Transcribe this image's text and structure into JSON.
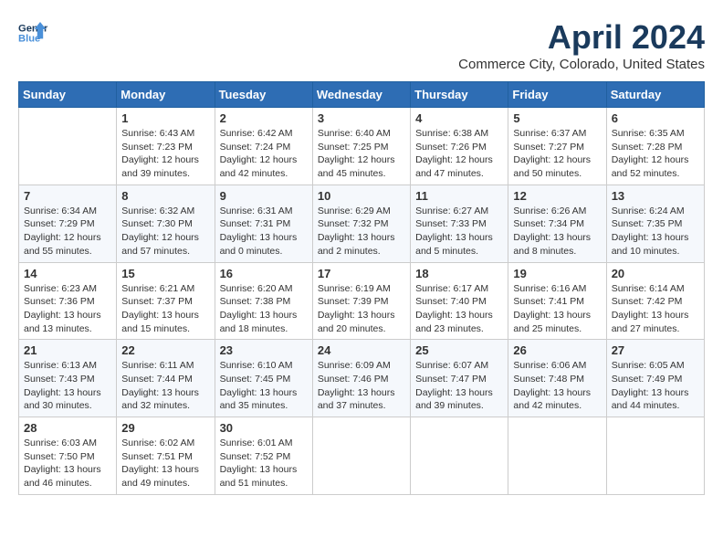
{
  "header": {
    "logo_general": "General",
    "logo_blue": "Blue",
    "month_year": "April 2024",
    "location": "Commerce City, Colorado, United States"
  },
  "days_of_week": [
    "Sunday",
    "Monday",
    "Tuesday",
    "Wednesday",
    "Thursday",
    "Friday",
    "Saturday"
  ],
  "weeks": [
    [
      {
        "day": "",
        "sunrise": "",
        "sunset": "",
        "daylight": ""
      },
      {
        "day": "1",
        "sunrise": "Sunrise: 6:43 AM",
        "sunset": "Sunset: 7:23 PM",
        "daylight": "Daylight: 12 hours and 39 minutes."
      },
      {
        "day": "2",
        "sunrise": "Sunrise: 6:42 AM",
        "sunset": "Sunset: 7:24 PM",
        "daylight": "Daylight: 12 hours and 42 minutes."
      },
      {
        "day": "3",
        "sunrise": "Sunrise: 6:40 AM",
        "sunset": "Sunset: 7:25 PM",
        "daylight": "Daylight: 12 hours and 45 minutes."
      },
      {
        "day": "4",
        "sunrise": "Sunrise: 6:38 AM",
        "sunset": "Sunset: 7:26 PM",
        "daylight": "Daylight: 12 hours and 47 minutes."
      },
      {
        "day": "5",
        "sunrise": "Sunrise: 6:37 AM",
        "sunset": "Sunset: 7:27 PM",
        "daylight": "Daylight: 12 hours and 50 minutes."
      },
      {
        "day": "6",
        "sunrise": "Sunrise: 6:35 AM",
        "sunset": "Sunset: 7:28 PM",
        "daylight": "Daylight: 12 hours and 52 minutes."
      }
    ],
    [
      {
        "day": "7",
        "sunrise": "Sunrise: 6:34 AM",
        "sunset": "Sunset: 7:29 PM",
        "daylight": "Daylight: 12 hours and 55 minutes."
      },
      {
        "day": "8",
        "sunrise": "Sunrise: 6:32 AM",
        "sunset": "Sunset: 7:30 PM",
        "daylight": "Daylight: 12 hours and 57 minutes."
      },
      {
        "day": "9",
        "sunrise": "Sunrise: 6:31 AM",
        "sunset": "Sunset: 7:31 PM",
        "daylight": "Daylight: 13 hours and 0 minutes."
      },
      {
        "day": "10",
        "sunrise": "Sunrise: 6:29 AM",
        "sunset": "Sunset: 7:32 PM",
        "daylight": "Daylight: 13 hours and 2 minutes."
      },
      {
        "day": "11",
        "sunrise": "Sunrise: 6:27 AM",
        "sunset": "Sunset: 7:33 PM",
        "daylight": "Daylight: 13 hours and 5 minutes."
      },
      {
        "day": "12",
        "sunrise": "Sunrise: 6:26 AM",
        "sunset": "Sunset: 7:34 PM",
        "daylight": "Daylight: 13 hours and 8 minutes."
      },
      {
        "day": "13",
        "sunrise": "Sunrise: 6:24 AM",
        "sunset": "Sunset: 7:35 PM",
        "daylight": "Daylight: 13 hours and 10 minutes."
      }
    ],
    [
      {
        "day": "14",
        "sunrise": "Sunrise: 6:23 AM",
        "sunset": "Sunset: 7:36 PM",
        "daylight": "Daylight: 13 hours and 13 minutes."
      },
      {
        "day": "15",
        "sunrise": "Sunrise: 6:21 AM",
        "sunset": "Sunset: 7:37 PM",
        "daylight": "Daylight: 13 hours and 15 minutes."
      },
      {
        "day": "16",
        "sunrise": "Sunrise: 6:20 AM",
        "sunset": "Sunset: 7:38 PM",
        "daylight": "Daylight: 13 hours and 18 minutes."
      },
      {
        "day": "17",
        "sunrise": "Sunrise: 6:19 AM",
        "sunset": "Sunset: 7:39 PM",
        "daylight": "Daylight: 13 hours and 20 minutes."
      },
      {
        "day": "18",
        "sunrise": "Sunrise: 6:17 AM",
        "sunset": "Sunset: 7:40 PM",
        "daylight": "Daylight: 13 hours and 23 minutes."
      },
      {
        "day": "19",
        "sunrise": "Sunrise: 6:16 AM",
        "sunset": "Sunset: 7:41 PM",
        "daylight": "Daylight: 13 hours and 25 minutes."
      },
      {
        "day": "20",
        "sunrise": "Sunrise: 6:14 AM",
        "sunset": "Sunset: 7:42 PM",
        "daylight": "Daylight: 13 hours and 27 minutes."
      }
    ],
    [
      {
        "day": "21",
        "sunrise": "Sunrise: 6:13 AM",
        "sunset": "Sunset: 7:43 PM",
        "daylight": "Daylight: 13 hours and 30 minutes."
      },
      {
        "day": "22",
        "sunrise": "Sunrise: 6:11 AM",
        "sunset": "Sunset: 7:44 PM",
        "daylight": "Daylight: 13 hours and 32 minutes."
      },
      {
        "day": "23",
        "sunrise": "Sunrise: 6:10 AM",
        "sunset": "Sunset: 7:45 PM",
        "daylight": "Daylight: 13 hours and 35 minutes."
      },
      {
        "day": "24",
        "sunrise": "Sunrise: 6:09 AM",
        "sunset": "Sunset: 7:46 PM",
        "daylight": "Daylight: 13 hours and 37 minutes."
      },
      {
        "day": "25",
        "sunrise": "Sunrise: 6:07 AM",
        "sunset": "Sunset: 7:47 PM",
        "daylight": "Daylight: 13 hours and 39 minutes."
      },
      {
        "day": "26",
        "sunrise": "Sunrise: 6:06 AM",
        "sunset": "Sunset: 7:48 PM",
        "daylight": "Daylight: 13 hours and 42 minutes."
      },
      {
        "day": "27",
        "sunrise": "Sunrise: 6:05 AM",
        "sunset": "Sunset: 7:49 PM",
        "daylight": "Daylight: 13 hours and 44 minutes."
      }
    ],
    [
      {
        "day": "28",
        "sunrise": "Sunrise: 6:03 AM",
        "sunset": "Sunset: 7:50 PM",
        "daylight": "Daylight: 13 hours and 46 minutes."
      },
      {
        "day": "29",
        "sunrise": "Sunrise: 6:02 AM",
        "sunset": "Sunset: 7:51 PM",
        "daylight": "Daylight: 13 hours and 49 minutes."
      },
      {
        "day": "30",
        "sunrise": "Sunrise: 6:01 AM",
        "sunset": "Sunset: 7:52 PM",
        "daylight": "Daylight: 13 hours and 51 minutes."
      },
      {
        "day": "",
        "sunrise": "",
        "sunset": "",
        "daylight": ""
      },
      {
        "day": "",
        "sunrise": "",
        "sunset": "",
        "daylight": ""
      },
      {
        "day": "",
        "sunrise": "",
        "sunset": "",
        "daylight": ""
      },
      {
        "day": "",
        "sunrise": "",
        "sunset": "",
        "daylight": ""
      }
    ]
  ]
}
